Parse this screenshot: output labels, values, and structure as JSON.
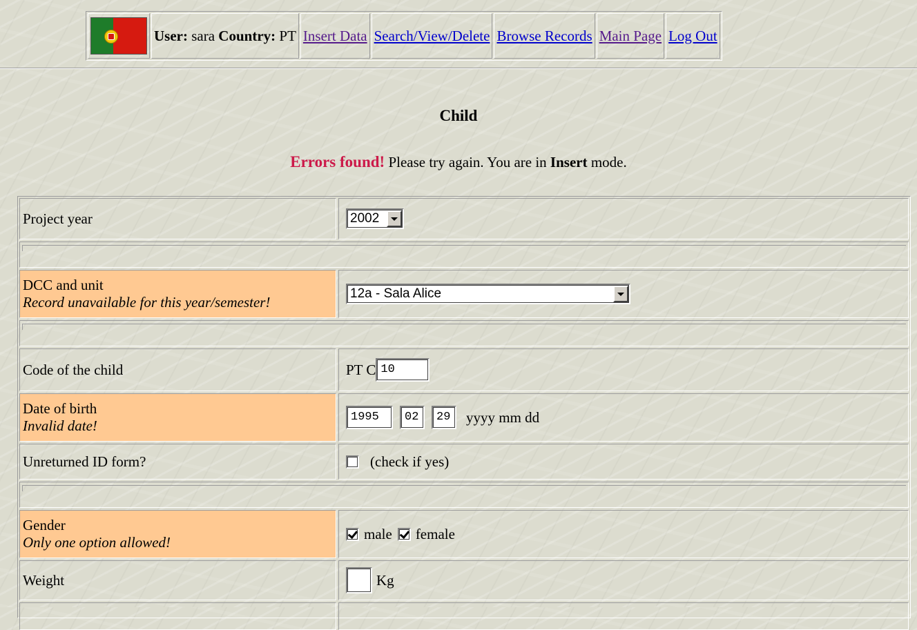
{
  "nav": {
    "flag_icon": "portugal-flag-icon",
    "user_label": "User:",
    "user_value": "sara",
    "country_label": "Country:",
    "country_value": "PT",
    "links": [
      "Insert Data",
      "Search/View/Delete",
      "Browse Records",
      "Main Page",
      "Log Out"
    ]
  },
  "page": {
    "title": "Child",
    "error_prefix": "Errors found!",
    "message_mid": " Please try again. You are in ",
    "mode": "Insert",
    "message_end": " mode."
  },
  "form": {
    "project_year": {
      "label": "Project year",
      "value": "2002"
    },
    "dcc_unit": {
      "label": "DCC and unit",
      "hint": "Record unavailable for this year/semester!",
      "value": "12a - Sala Alice"
    },
    "child_code": {
      "label": "Code of the child",
      "prefix": "PT C",
      "value": "10"
    },
    "dob": {
      "label": "Date of birth",
      "hint": "Invalid date!",
      "year": "1995",
      "month": "02",
      "day": "29",
      "format": "yyyy mm dd"
    },
    "unreturned_id": {
      "label": "Unreturned ID form?",
      "option": "(check if yes)",
      "checked": false
    },
    "gender": {
      "label": "Gender",
      "hint": "Only one option allowed!",
      "male": "male",
      "female": "female",
      "male_checked": true,
      "female_checked": true
    },
    "weight": {
      "label": "Weight",
      "value": "",
      "unit": "Kg"
    }
  },
  "colors": {
    "error_bg": "#ffc992",
    "error_text": "#cc1a4a",
    "link": "#0000cc",
    "visited": "#551a8b"
  }
}
